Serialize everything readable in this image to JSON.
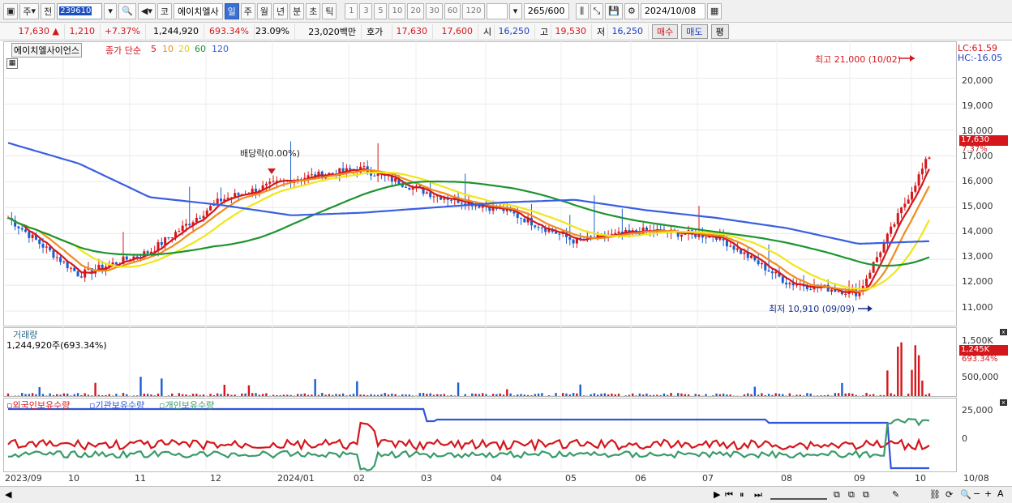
{
  "toolbar": {
    "type_label": "주",
    "prev_label": "전",
    "stock_code": "239610",
    "market_label": "코",
    "stock_name": "에이치엘사",
    "periods": [
      "일",
      "주",
      "월",
      "년",
      "분",
      "초",
      "틱"
    ],
    "active_period": "일",
    "intervals": [
      "1",
      "3",
      "5",
      "10",
      "20",
      "30",
      "60",
      "120"
    ],
    "count_value": "265",
    "count_max": "/600",
    "date": "2024/10/08"
  },
  "quote": {
    "price": "17,630",
    "change_arrow": "▲",
    "change": "1,210",
    "change_pct": "+7.37%",
    "volume": "1,244,920",
    "volume_pct": "693.34%",
    "turnover": "23.09%",
    "amount": "23,020백만",
    "ask_label": "호가",
    "ask1": "17,630",
    "ask2": "17,600",
    "open_label": "시",
    "open": "16,250",
    "high_label": "고",
    "high": "19,530",
    "low_label": "저",
    "low": "16,250",
    "buy_label": "매수",
    "sell_label": "매도",
    "avg_label": "평"
  },
  "price_panel": {
    "title": "에이치엘사이언스",
    "ma_title": "종가 단순",
    "ma_periods": [
      "5",
      "10",
      "20",
      "60",
      "120"
    ],
    "ma_colors": [
      "#d4171c",
      "#f08c1e",
      "#f0e619",
      "#1e9430",
      "#3a5ee0"
    ],
    "lc": "LC:61.59",
    "hc": "HC:-16.05",
    "y_ticks": [
      "20,000",
      "19,000",
      "18,000",
      "17,000",
      "16,000",
      "15,000",
      "14,000",
      "13,000",
      "12,000",
      "11,000"
    ],
    "current_tag": "17,630",
    "current_pct": "7.37%",
    "high_annot": "최고 21,000 (10/02)",
    "low_annot": "최저 10,910 (09/09)",
    "div_annot": "배당락(0.00%)"
  },
  "volume_panel": {
    "title": "거래량",
    "value": "1,244,920주(693.34%)",
    "y_ticks": [
      "1,500K",
      "500,000"
    ],
    "tag": "1,245K",
    "tag_pct": "693.34%"
  },
  "holding_panel": {
    "legend": [
      "외국인보유수량",
      "기관보유수량",
      "개인보유수량"
    ],
    "legend_colors": [
      "#d4171c",
      "#2f55d8",
      "#3a9a6a"
    ],
    "y_ticks": [
      "25,000",
      "0"
    ]
  },
  "x_axis": [
    "2023/09",
    "10",
    "11",
    "12",
    "2024/01",
    "02",
    "03",
    "04",
    "05",
    "06",
    "07",
    "08",
    "09",
    "10",
    "10/08"
  ],
  "chart_data": {
    "type": "line",
    "title": "에이치엘사이언스",
    "ylim": [
      10500,
      21300
    ],
    "x": [
      "2023/09",
      "10",
      "11",
      "12",
      "2024/01",
      "02",
      "03",
      "04",
      "05",
      "06",
      "07",
      "08",
      "09",
      "10"
    ],
    "series": [
      {
        "name": "5",
        "values": [
          14600,
          12400,
          13300,
          15300,
          16100,
          16500,
          15500,
          14900,
          13700,
          14100,
          13900,
          12100,
          11700,
          17000
        ]
      },
      {
        "name": "120",
        "values": [
          17500,
          16700,
          15400,
          15100,
          14700,
          14800,
          15000,
          15200,
          15300,
          14900,
          14600,
          14200,
          13600,
          13700
        ]
      }
    ]
  }
}
